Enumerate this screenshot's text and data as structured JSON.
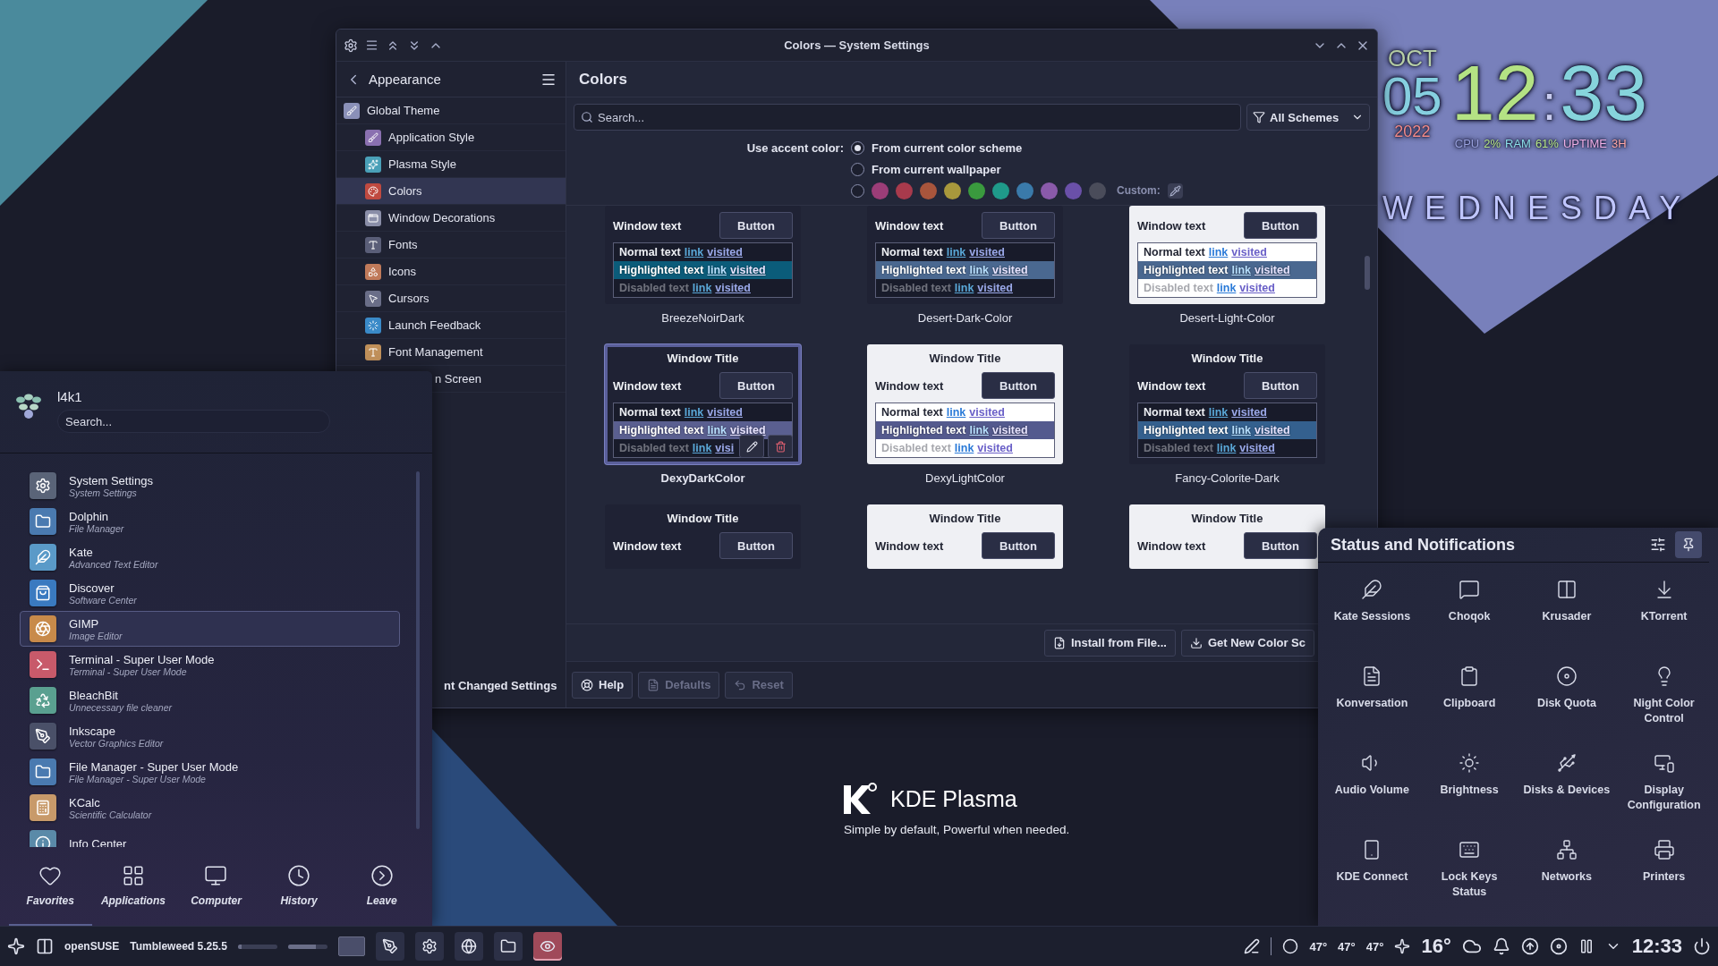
{
  "window": {
    "title": "Colors — System Settings"
  },
  "sidebar": {
    "title": "Appearance",
    "items": [
      {
        "label": "Global Theme",
        "selected": false,
        "children": [
          {
            "label": "Application Style",
            "selected": false
          },
          {
            "label": "Plasma Style",
            "selected": false
          },
          {
            "label": "Colors",
            "selected": true
          },
          {
            "label": "Window Decorations",
            "selected": false
          },
          {
            "label": "Fonts",
            "selected": false
          },
          {
            "label": "Icons",
            "selected": false
          },
          {
            "label": "Cursors",
            "selected": false
          },
          {
            "label": "Launch Feedback",
            "selected": false
          },
          {
            "label": "Font Management",
            "selected": false
          },
          {
            "label": "n Screen",
            "selected": false,
            "kind": "clipped"
          }
        ]
      }
    ],
    "footer_button": "nt Changed Settings"
  },
  "page": {
    "title": "Colors",
    "search": {
      "placeholder": "Search..."
    },
    "filter": "All Schemes",
    "accent": {
      "label": "Use accent color:",
      "options": [
        {
          "label": "From current color scheme",
          "selected": true
        },
        {
          "label": "From current wallpaper",
          "selected": false
        },
        {
          "kind": "palette",
          "selected": false,
          "custom_label": "Custom:",
          "colors": [
            {
              "color": "#9c3d78",
              "selected": false
            },
            {
              "color": "#a83a4c",
              "selected": false
            },
            {
              "color": "#a8553c",
              "selected": false
            },
            {
              "color": "#a8983c",
              "selected": false
            },
            {
              "color": "#3a9a3e",
              "selected": false
            },
            {
              "color": "#1f9a8a",
              "selected": false
            },
            {
              "color": "#3a7aaa",
              "selected": false
            },
            {
              "color": "#8a5aaa",
              "selected": false
            },
            {
              "color": "#6a50a8",
              "selected": false
            },
            {
              "color": "#4a4c5a",
              "selected": false
            }
          ]
        }
      ]
    },
    "schemes": [
      {
        "name": "BreezeNoirDark",
        "kind": "dark",
        "color": "#0b5c7a",
        "window_text": "Window text",
        "button": "Button",
        "selected": false,
        "hovered": false,
        "lines": [
          {
            "label": "Normal text",
            "link": "link",
            "visited": "visited"
          },
          {
            "label": "Highlighted text",
            "link": "link",
            "visited": "visited"
          },
          {
            "label": "Disabled text",
            "link": "link",
            "visited": "visited"
          }
        ]
      },
      {
        "name": "Desert-Dark-Color",
        "kind": "dark",
        "color": "#4a6890",
        "window_text": "Window text",
        "button": "Button",
        "selected": false,
        "hovered": false,
        "lines": [
          {
            "label": "Normal text",
            "link": "link",
            "visited": "visited"
          },
          {
            "label": "Highlighted text",
            "link": "link",
            "visited": "visited"
          },
          {
            "label": "Disabled text",
            "link": "link",
            "visited": "visited"
          }
        ]
      },
      {
        "name": "Desert-Light-Color",
        "kind": "light",
        "color": "#4a6890",
        "window_text": "Window text",
        "button": "Button",
        "selected": false,
        "hovered": false,
        "lines": [
          {
            "label": "Normal text",
            "link": "link",
            "visited": "visited"
          },
          {
            "label": "Highlighted text",
            "link": "link",
            "visited": "visited"
          },
          {
            "label": "Disabled text",
            "link": "link",
            "visited": "visited"
          }
        ]
      },
      {
        "name": "DexyDarkColor",
        "kind": "dark",
        "color": "#5a5f90",
        "title": "Window Title",
        "window_text": "Window text",
        "button": "Button",
        "selected": true,
        "hovered": true,
        "lines": [
          {
            "label": "Normal text",
            "link": "link",
            "visited": "visited"
          },
          {
            "label": "Highlighted text",
            "link": "link",
            "visited": "visited"
          },
          {
            "label": "Disabled text",
            "link": "link",
            "visited": "visi"
          }
        ]
      },
      {
        "name": "DexyLightColor",
        "kind": "light",
        "color": "#545a8e",
        "title": "Window Title",
        "window_text": "Window text",
        "button": "Button",
        "selected": false,
        "hovered": false,
        "lines": [
          {
            "label": "Normal text",
            "link": "link",
            "visited": "visited"
          },
          {
            "label": "Highlighted text",
            "link": "link",
            "visited": "visited"
          },
          {
            "label": "Disabled text",
            "link": "link",
            "visited": "visited"
          }
        ]
      },
      {
        "name": "Fancy-Colorite-Dark",
        "kind": "dark",
        "color": "#34608e",
        "title": "Window Title",
        "window_text": "Window text",
        "button": "Button",
        "selected": false,
        "hovered": false,
        "lines": [
          {
            "label": "Normal text",
            "link": "link",
            "visited": "visited"
          },
          {
            "label": "Highlighted text",
            "link": "link",
            "visited": "visited"
          },
          {
            "label": "Disabled text",
            "link": "link",
            "visited": "visited"
          }
        ]
      },
      {
        "kind": "dark",
        "title": "Window Title",
        "window_text": "Window text",
        "button": "Button",
        "selected": false,
        "hovered": false
      },
      {
        "kind": "light",
        "title": "Window Title",
        "window_text": "Window text",
        "button": "Button",
        "selected": false,
        "hovered": false
      },
      {
        "kind": "light",
        "title": "Window Title",
        "window_text": "Window text",
        "button": "Button",
        "selected": false,
        "hovered": false
      }
    ],
    "actions": [
      "Install from File...",
      "Get New Color Sc"
    ],
    "footer": [
      {
        "label": "Help",
        "disabled": false
      },
      {
        "label": "Defaults",
        "disabled": true
      },
      {
        "label": "Reset",
        "disabled": true
      }
    ]
  },
  "launcher": {
    "user": "l4k1",
    "search": {
      "placeholder": "Search..."
    },
    "apps": [
      {
        "name": "System Settings",
        "subtitle": "System Settings",
        "selected": false
      },
      {
        "name": "Dolphin",
        "subtitle": "File Manager",
        "selected": false
      },
      {
        "name": "Kate",
        "subtitle": "Advanced Text Editor",
        "selected": false
      },
      {
        "name": "Discover",
        "subtitle": "Software Center",
        "selected": false
      },
      {
        "name": "GIMP",
        "subtitle": "Image Editor",
        "selected": true
      },
      {
        "name": "Terminal - Super User Mode",
        "subtitle": "Terminal - Super User Mode",
        "selected": false
      },
      {
        "name": "BleachBit",
        "subtitle": "Unnecessary file cleaner",
        "selected": false
      },
      {
        "name": "Inkscape",
        "subtitle": "Vector Graphics Editor",
        "selected": false
      },
      {
        "name": "File Manager - Super User Mode",
        "subtitle": "File Manager - Super User Mode",
        "selected": false
      },
      {
        "name": "KCalc",
        "subtitle": "Scientific Calculator",
        "selected": false
      },
      {
        "name": "Info Center",
        "selected": false
      }
    ],
    "tabs": [
      {
        "label": "Favorites",
        "selected": true
      },
      {
        "label": "Applications",
        "selected": false
      },
      {
        "label": "Computer",
        "selected": false
      },
      {
        "label": "History",
        "selected": false
      },
      {
        "label": "Leave",
        "selected": false
      }
    ]
  },
  "notifications": {
    "title": "Status and Notifications",
    "pinned": true,
    "items": [
      "Kate Sessions",
      "Choqok",
      "Krusader",
      "KTorrent",
      "Konversation",
      "Clipboard",
      "Disk Quota",
      "Night Color Control",
      "Audio Volume",
      "Brightness",
      "Disks & Devices",
      "Display Configuration",
      "KDE Connect",
      "Lock Keys Status",
      "Networks",
      "Printers"
    ]
  },
  "taskbar": {
    "distro": "openSUSE",
    "version": "Tumbleweed 5.25.5",
    "tasks": [
      {
        "active": false
      },
      {
        "active": false
      },
      {
        "active": false
      },
      {
        "active": false
      },
      {
        "active": true
      }
    ],
    "temperatures": [
      "47°",
      "47°",
      "47°"
    ],
    "weather": "16°",
    "clock": "12:33"
  },
  "clock": {
    "month": "OCT",
    "day": "05",
    "year": "2022",
    "hours": "12",
    "separator": ":",
    "minutes": "33",
    "stats": [
      {
        "text": "CPU",
        "color": "#9aa2e0"
      },
      {
        "text": "2%",
        "color": "#b8e888"
      },
      {
        "text": "RAM",
        "color": "#8ce0ea"
      },
      {
        "text": "61%",
        "color": "#b8e888"
      },
      {
        "text": "UPTIME",
        "color": "#f0b0e8"
      },
      {
        "text": "3H",
        "color": "#ffa8a8"
      }
    ],
    "weekday": "WEDNESDAY"
  },
  "brand": {
    "name": "KDE Plasma",
    "tagline": "Simple by default, Powerful when needed."
  }
}
